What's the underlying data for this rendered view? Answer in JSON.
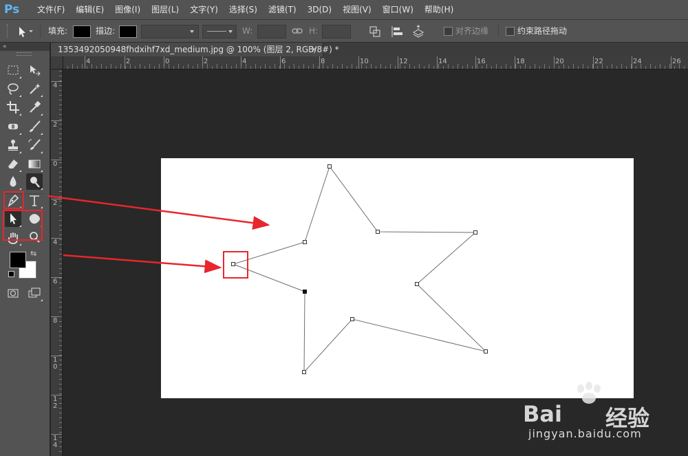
{
  "app": {
    "logo": "Ps"
  },
  "menu": [
    "文件(F)",
    "编辑(E)",
    "图像(I)",
    "图层(L)",
    "文字(Y)",
    "选择(S)",
    "滤镜(T)",
    "3D(D)",
    "视图(V)",
    "窗口(W)",
    "帮助(H)"
  ],
  "options": {
    "fill_label": "填充:",
    "stroke_label": "描边:",
    "w_label": "W:",
    "h_label": "H:",
    "align_edges": "对齐边缘",
    "constrain_path": "约束路径拖动"
  },
  "document": {
    "tab_title": "1353492050948fhdxihf7xd_medium.jpg @ 100% (图层 2, RGB/8#) *",
    "close": "×"
  },
  "ruler": {
    "top_labels": [
      "4",
      "2",
      "0",
      "2",
      "4",
      "6",
      "8",
      "10",
      "12",
      "14",
      "16",
      "18",
      "20",
      "22",
      "24",
      "26"
    ],
    "left_labels": [
      "4",
      "2",
      "0",
      "2",
      "4",
      "6",
      "8",
      "10",
      "12",
      "14"
    ]
  },
  "colors": {
    "highlight": "#e8262d",
    "foreground": "#000000",
    "background": "#ffffff",
    "canvas": "#ffffff"
  },
  "watermark": {
    "brand": "Bai",
    "brand_cn": "经验",
    "url": "jingyan.baidu.com"
  }
}
